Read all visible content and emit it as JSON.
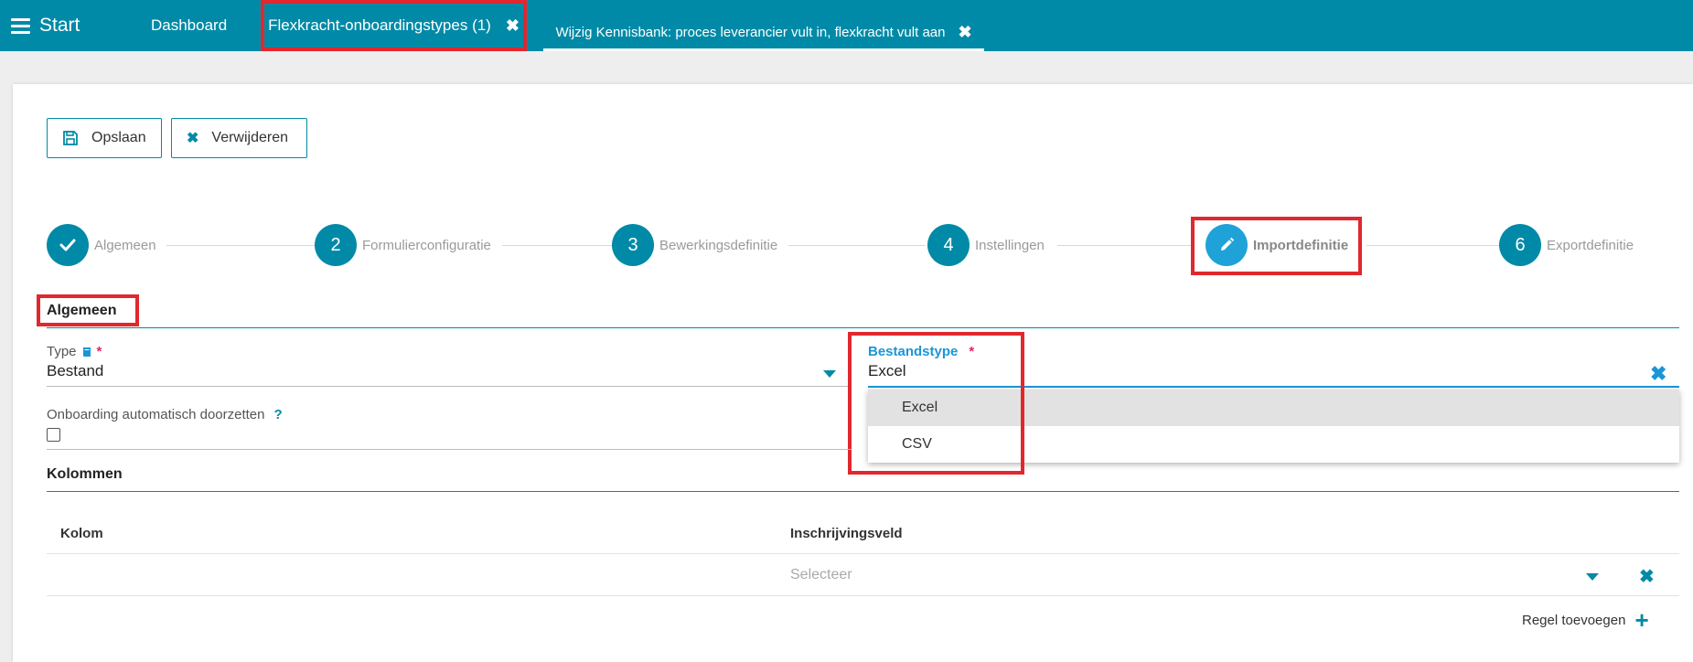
{
  "topbar": {
    "start_label": "Start",
    "tabs": [
      {
        "label": "Dashboard"
      },
      {
        "label": "Flexkracht-onboardingstypes (1)"
      },
      {
        "label": "Wijzig Kennisbank: proces leverancier vult in, flexkracht vult aan"
      }
    ],
    "close_glyph": "✖"
  },
  "toolbar": {
    "save_label": "Opslaan",
    "delete_label": "Verwijderen",
    "delete_glyph": "✖"
  },
  "stepper": {
    "steps": [
      {
        "number": "",
        "label": "Algemeen",
        "state": "done",
        "icon": "check-icon"
      },
      {
        "number": "2",
        "label": "Formulierconfiguratie",
        "state": "todo"
      },
      {
        "number": "3",
        "label": "Bewerkingsdefinitie",
        "state": "todo"
      },
      {
        "number": "4",
        "label": "Instellingen",
        "state": "todo"
      },
      {
        "number": "",
        "label": "Importdefinitie",
        "state": "active",
        "icon": "pencil-icon"
      },
      {
        "number": "6",
        "label": "Exportdefinitie",
        "state": "todo"
      }
    ]
  },
  "algemeen": {
    "title": "Algemeen",
    "type_label": "Type",
    "type_value": "Bestand",
    "required_mark": "*",
    "bestandstype_label": "Bestandstype",
    "bestandstype_value": "Excel",
    "bestandstype_options": [
      "Excel",
      "CSV"
    ],
    "auto_label": "Onboarding automatisch doorzetten",
    "auto_help": "?",
    "clear_glyph": "✖"
  },
  "kolommen": {
    "title": "Kolommen",
    "columns": [
      "Kolom",
      "Inschrijvingsveld"
    ],
    "select_placeholder": "Selecteer",
    "row_delete_glyph": "✖",
    "add_row_label": "Regel toevoegen",
    "add_glyph": "+"
  },
  "colors": {
    "primary": "#008aa7",
    "active_step": "#1ea2d8",
    "focus": "#1a96d6",
    "highlight": "#e0282e",
    "required": "#e0285a"
  }
}
